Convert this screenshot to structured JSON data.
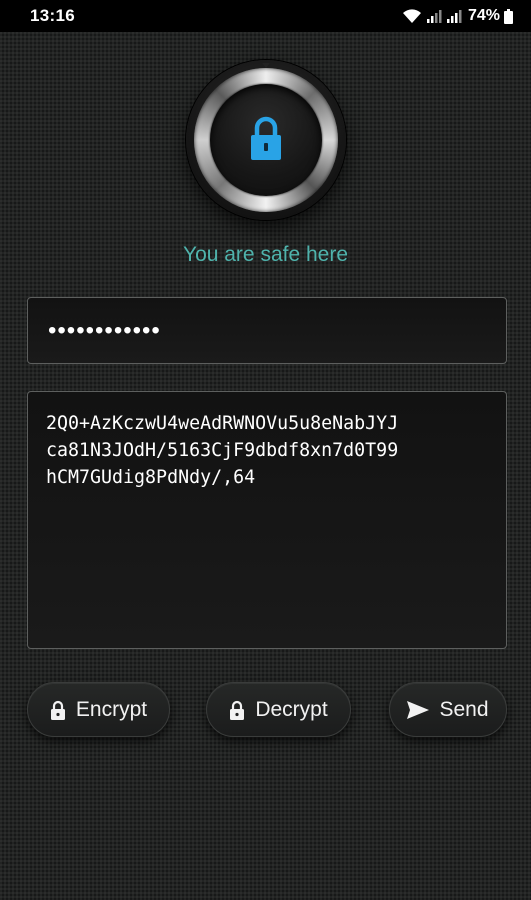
{
  "status_bar": {
    "time": "13:16",
    "battery": "74%",
    "icons": [
      "wifi-icon",
      "signal-icon",
      "battery-icon"
    ]
  },
  "lock": {
    "icon": "lock-icon",
    "accent_color": "#29a3e6"
  },
  "tagline": "You are safe here",
  "password": {
    "value": "••••••••••••"
  },
  "message": {
    "lines": [
      "2Q0+AzKczwU4weAdRWNOVu5u8eNabJYJ",
      "ca81N3JOdH/5163CjF9dbdf8xn7d0T99",
      "hCM7GUdig8PdNdy/,64"
    ]
  },
  "buttons": {
    "encrypt": "Encrypt",
    "decrypt": "Decrypt",
    "send": "Send"
  },
  "colors": {
    "tagline": "#4fb3ac",
    "background": "#222423"
  }
}
